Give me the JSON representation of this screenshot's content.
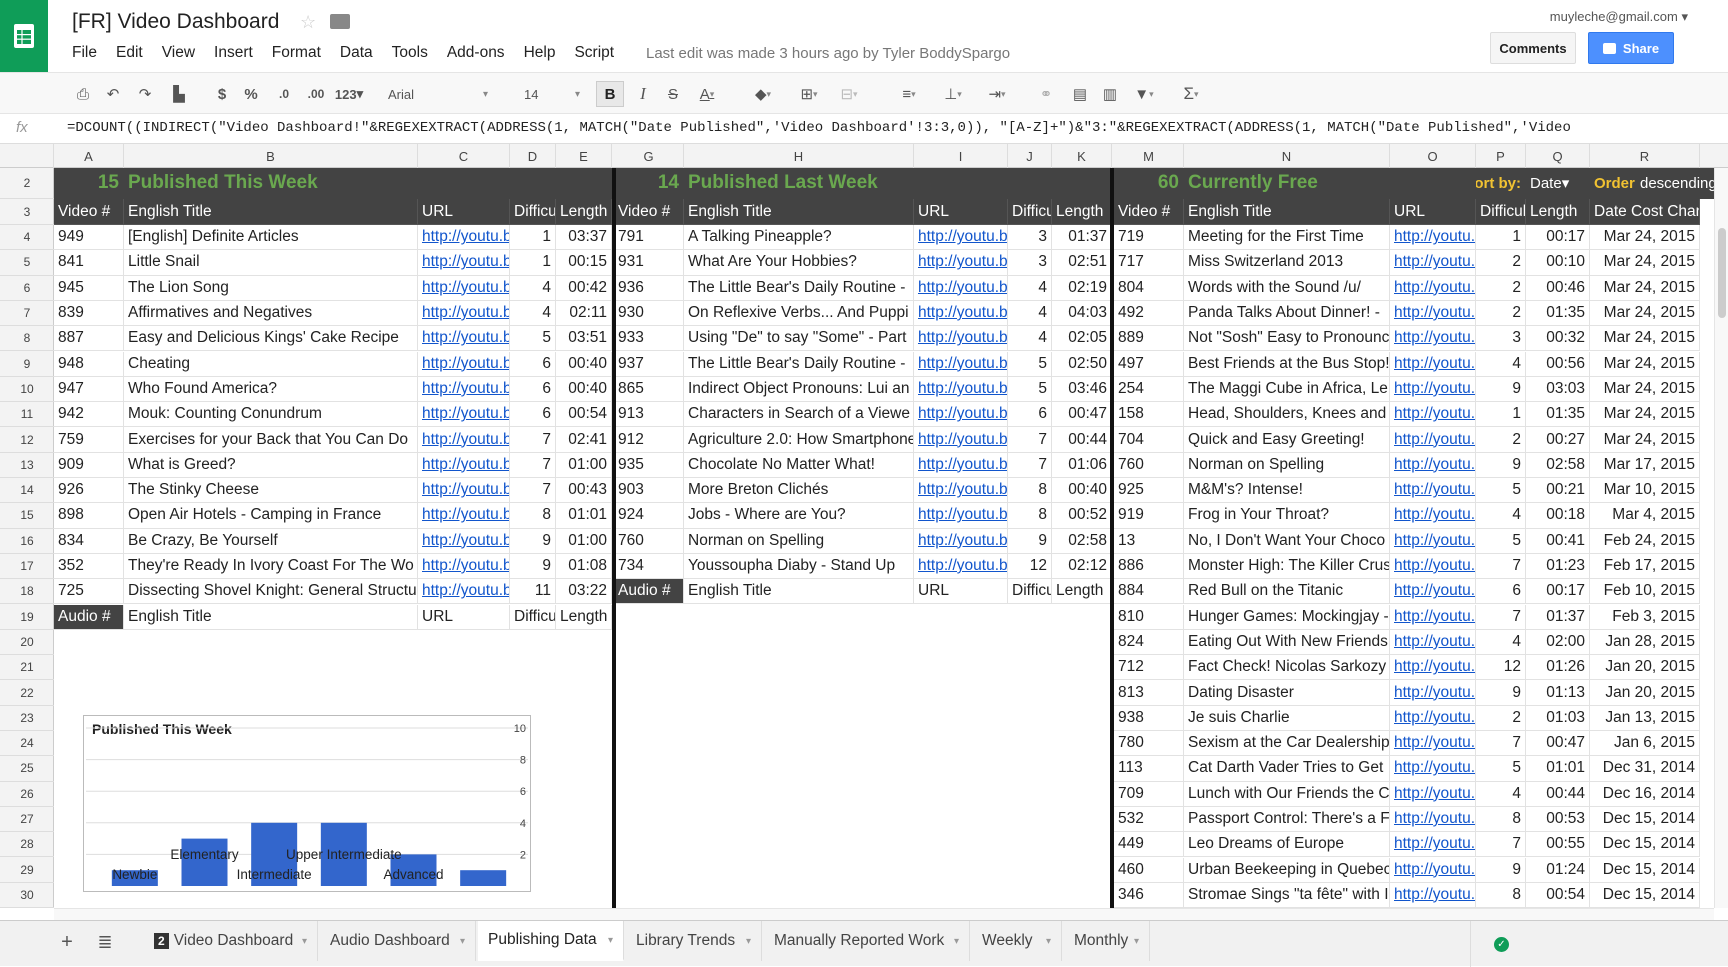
{
  "app": {
    "title": "[FR] Video Dashboard",
    "account": "muyleche@gmail.com",
    "last_edit": "Last edit was made 3 hours ago by Tyler BoddySpargo",
    "comments_label": "Comments",
    "share_label": "Share",
    "menu": [
      "File",
      "Edit",
      "View",
      "Insert",
      "Format",
      "Data",
      "Tools",
      "Add-ons",
      "Help",
      "Script"
    ]
  },
  "toolbar": {
    "font": "Arial",
    "font_size": "14",
    "number_format": "123",
    "currency": "$",
    "percent": "%",
    "decrease_decimals": ".0",
    "increase_decimals": ".00",
    "bold": "B",
    "italic": "I",
    "strikethrough": "S",
    "text_color": "A",
    "sum": "Σ"
  },
  "formula_bar": {
    "fx": "fx",
    "formula": "=DCOUNT((INDIRECT(\"Video Dashboard!\"&REGEXEXTRACT(ADDRESS(1, MATCH(\"Date Published\",'Video Dashboard'!3:3,0)), \"[A-Z]+\")&\"3:\"&REGEXEXTRACT(ADDRESS(1, MATCH(\"Date Published\",'Video"
  },
  "columns": [
    "A",
    "B",
    "C",
    "D",
    "E",
    "G",
    "H",
    "I",
    "J",
    "K",
    "M",
    "N",
    "O",
    "P",
    "Q",
    "R"
  ],
  "rows": [
    "2",
    "3",
    "4",
    "5",
    "6",
    "7",
    "8",
    "9",
    "10",
    "11",
    "12",
    "13",
    "14",
    "15",
    "16",
    "17",
    "18",
    "19",
    "20",
    "21",
    "22",
    "23",
    "24",
    "25",
    "26",
    "27",
    "28",
    "29",
    "30"
  ],
  "sections": {
    "this_week": {
      "count": "15",
      "label": "Published This Week"
    },
    "last_week": {
      "count": "14",
      "label": "Published Last Week"
    },
    "free": {
      "count": "60",
      "label": "Currently Free"
    },
    "sort_by_label": "Sort by:",
    "sort_by_value": "Date",
    "order_label": "Order:",
    "order_value": "descending"
  },
  "headers": {
    "left": [
      "Video #",
      "English Title",
      "URL",
      "Difficu",
      "Length"
    ],
    "mid": [
      "Video #",
      "English Title",
      "URL",
      "Difficu",
      "Length"
    ],
    "right": [
      "Video #",
      "English Title",
      "URL",
      "Difficul",
      "Length",
      "Date Cost Chan"
    ]
  },
  "audio_headers": {
    "left": [
      "Audio #",
      "English Title",
      "URL",
      "Difficu",
      "Length"
    ],
    "mid": [
      "Audio #",
      "English Title",
      "URL",
      "Difficu",
      "Length"
    ]
  },
  "table_left": [
    [
      "949",
      "[English] Definite Articles",
      "http://youtu.b",
      "1",
      "03:37"
    ],
    [
      "841",
      "Little Snail",
      "http://youtu.b",
      "1",
      "00:15"
    ],
    [
      "945",
      "The Lion Song",
      "http://youtu.b",
      "4",
      "00:42"
    ],
    [
      "839",
      "Affirmatives and Negatives",
      "http://youtu.b",
      "4",
      "02:11"
    ],
    [
      "887",
      "Easy and Delicious Kings' Cake Recipe",
      "http://youtu.b",
      "5",
      "03:51"
    ],
    [
      "948",
      "Cheating",
      "http://youtu.b",
      "6",
      "00:40"
    ],
    [
      "947",
      "Who Found America?",
      "http://youtu.b",
      "6",
      "00:40"
    ],
    [
      "942",
      "Mouk: Counting Conundrum",
      "http://youtu.b",
      "6",
      "00:54"
    ],
    [
      "759",
      "Exercises for your Back that You Can Do",
      "http://youtu.b",
      "7",
      "02:41"
    ],
    [
      "909",
      "What is Greed?",
      "http://youtu.b",
      "7",
      "01:00"
    ],
    [
      "926",
      "The Stinky Cheese",
      "http://youtu.b",
      "7",
      "00:43"
    ],
    [
      "898",
      "Open Air Hotels - Camping in France",
      "http://youtu.b",
      "8",
      "01:01"
    ],
    [
      "834",
      "Be Crazy, Be Yourself",
      "http://youtu.b",
      "9",
      "01:00"
    ],
    [
      "352",
      "They're Ready In Ivory Coast For The Wo",
      "http://youtu.b",
      "9",
      "01:08"
    ],
    [
      "725",
      "Dissecting Shovel Knight: General Structu",
      "http://youtu.b",
      "11",
      "03:22"
    ]
  ],
  "table_mid": [
    [
      "791",
      "A Talking Pineapple?",
      "http://youtu.b",
      "3",
      "01:37"
    ],
    [
      "931",
      "What Are Your Hobbies?",
      "http://youtu.b",
      "3",
      "02:51"
    ],
    [
      "936",
      "The Little Bear's Daily Routine -",
      "http://youtu.b",
      "4",
      "02:19"
    ],
    [
      "930",
      "On Reflexive Verbs... And Puppi",
      "http://youtu.b",
      "4",
      "04:03"
    ],
    [
      "933",
      "Using \"De\" to say \"Some\" - Part",
      "http://youtu.b",
      "4",
      "02:05"
    ],
    [
      "937",
      "The Little Bear's Daily Routine -",
      "http://youtu.b",
      "5",
      "02:50"
    ],
    [
      "865",
      "Indirect Object Pronouns: Lui an",
      "http://youtu.b",
      "5",
      "03:46"
    ],
    [
      "913",
      "Characters in Search of a Viewe",
      "http://youtu.b",
      "6",
      "00:47"
    ],
    [
      "912",
      "Agriculture 2.0: How Smartphone",
      "http://youtu.b",
      "7",
      "00:44"
    ],
    [
      "935",
      "Chocolate No Matter What!",
      "http://youtu.b",
      "7",
      "01:06"
    ],
    [
      "903",
      "More Breton Clichés",
      "http://youtu.b",
      "8",
      "00:40"
    ],
    [
      "924",
      "Jobs - Where are You?",
      "http://youtu.b",
      "8",
      "00:52"
    ],
    [
      "760",
      "Norman on Spelling",
      "http://youtu.b",
      "9",
      "02:58"
    ],
    [
      "734",
      "Youssoupha Diaby - Stand Up",
      "http://youtu.b",
      "12",
      "02:12"
    ]
  ],
  "table_right": [
    [
      "719",
      "Meeting for the First Time",
      "http://youtu.",
      "1",
      "00:17",
      "Mar 24, 2015"
    ],
    [
      "717",
      "Miss Switzerland 2013",
      "http://youtu.",
      "2",
      "00:10",
      "Mar 24, 2015"
    ],
    [
      "804",
      "Words with the Sound /u/",
      "http://youtu.",
      "2",
      "00:46",
      "Mar 24, 2015"
    ],
    [
      "492",
      "Panda Talks About Dinner! -",
      "http://youtu.",
      "2",
      "01:35",
      "Mar 24, 2015"
    ],
    [
      "889",
      "Not \"Sosh\" Easy to Pronounc",
      "http://youtu.",
      "3",
      "00:32",
      "Mar 24, 2015"
    ],
    [
      "497",
      "Best Friends at the Bus Stop!",
      "http://youtu.",
      "4",
      "00:56",
      "Mar 24, 2015"
    ],
    [
      "254",
      "The Maggi Cube in Africa, Le",
      "http://youtu.",
      "9",
      "03:03",
      "Mar 24, 2015"
    ],
    [
      "158",
      "Head, Shoulders, Knees and",
      "http://youtu.",
      "1",
      "01:35",
      "Mar 24, 2015"
    ],
    [
      "704",
      "Quick and Easy Greeting!",
      "http://youtu.",
      "2",
      "00:27",
      "Mar 24, 2015"
    ],
    [
      "760",
      "Norman on Spelling",
      "http://youtu.",
      "9",
      "02:58",
      "Mar 17, 2015"
    ],
    [
      "925",
      "M&M's? Intense!",
      "http://youtu.",
      "5",
      "00:21",
      "Mar 10, 2015"
    ],
    [
      "919",
      "Frog in Your Throat?",
      "http://youtu.",
      "4",
      "00:18",
      "Mar 4, 2015"
    ],
    [
      "13",
      "No, I Don't Want Your Choco",
      "http://youtu.",
      "5",
      "00:41",
      "Feb 24, 2015"
    ],
    [
      "886",
      "Monster High: The Killer Crus",
      "http://youtu.",
      "7",
      "01:23",
      "Feb 17, 2015"
    ],
    [
      "884",
      "Red Bull on the Titanic",
      "http://youtu.",
      "6",
      "00:17",
      "Feb 10, 2015"
    ],
    [
      "810",
      "Hunger Games: Mockingjay -",
      "http://youtu.",
      "7",
      "01:37",
      "Feb 3, 2015"
    ],
    [
      "824",
      "Eating Out With New Friends",
      "http://youtu.",
      "4",
      "02:00",
      "Jan 28, 2015"
    ],
    [
      "712",
      "Fact Check! Nicolas Sarkozy",
      "http://youtu.",
      "12",
      "01:26",
      "Jan 20, 2015"
    ],
    [
      "813",
      "Dating Disaster",
      "http://youtu.",
      "9",
      "01:13",
      "Jan 20, 2015"
    ],
    [
      "938",
      "Je suis Charlie",
      "http://youtu.",
      "2",
      "01:03",
      "Jan 13, 2015"
    ],
    [
      "780",
      "Sexism at the Car Dealership",
      "http://youtu.",
      "7",
      "00:47",
      "Jan 6, 2015"
    ],
    [
      "113",
      "Cat Darth Vader Tries to Get",
      "http://youtu.",
      "5",
      "01:01",
      "Dec 31, 2014"
    ],
    [
      "709",
      "Lunch with Our Friends the C",
      "http://youtu.",
      "4",
      "00:44",
      "Dec 16, 2014"
    ],
    [
      "532",
      "Passport Control: There's a F",
      "http://youtu.",
      "8",
      "00:53",
      "Dec 15, 2014"
    ],
    [
      "449",
      "Leo Dreams of Europe",
      "http://youtu.",
      "7",
      "00:55",
      "Dec 15, 2014"
    ],
    [
      "460",
      "Urban Beekeeping in Quebec",
      "http://youtu.",
      "9",
      "01:24",
      "Dec 15, 2014"
    ],
    [
      "346",
      "Stromae Sings \"ta fête\" with I",
      "http://youtu.",
      "8",
      "00:54",
      "Dec 15, 2014"
    ]
  ],
  "chart_data": {
    "type": "bar",
    "title": "Published This Week",
    "bar_color": "#3366cc",
    "ylim": [
      0,
      10
    ],
    "yticks": [
      "2",
      "4",
      "6",
      "8",
      "10"
    ],
    "categories": [
      "Newbie",
      "Elementary",
      "Intermediate",
      "Upper Intermediate",
      "Advanced",
      ""
    ],
    "values": [
      1,
      3,
      4,
      4,
      2,
      1
    ]
  },
  "sheet_tabs": [
    {
      "label": "Video Dashboard",
      "badge": "2"
    },
    {
      "label": "Audio Dashboard"
    },
    {
      "label": "Publishing Data",
      "active": true
    },
    {
      "label": "Library Trends"
    },
    {
      "label": "Manually Reported Work"
    },
    {
      "label": "Weekly"
    },
    {
      "label": "Monthly"
    }
  ]
}
